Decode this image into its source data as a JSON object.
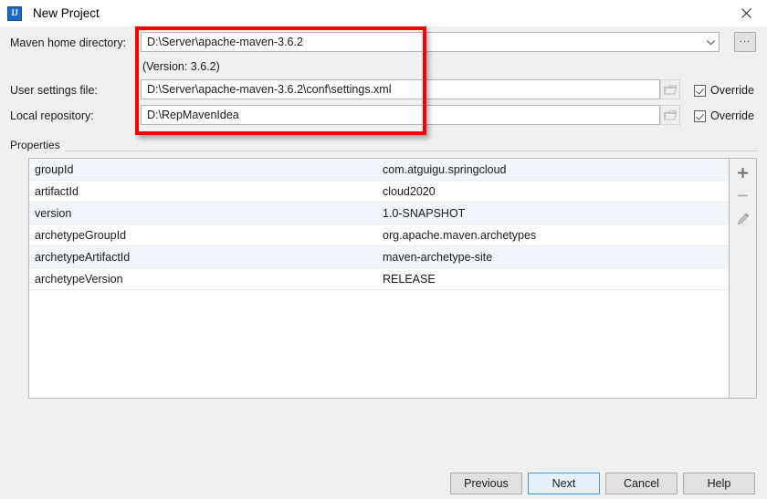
{
  "window": {
    "title": "New Project",
    "app_icon": "intellij-idea-icon",
    "close_icon": "close-icon"
  },
  "form": {
    "maven_home": {
      "label": "Maven home directory:",
      "value": "D:\\Server\\apache-maven-3.6.2",
      "placeholder": "",
      "dropdown_icon": "chevron-down-icon",
      "browse_label": "...",
      "version_note": "(Version: 3.6.2)"
    },
    "user_settings": {
      "label": "User settings file:",
      "value": "D:\\Server\\apache-maven-3.6.2\\conf\\settings.xml",
      "placeholder": "",
      "browse_icon": "folder-icon",
      "override_label": "Override",
      "override_checked": true
    },
    "local_repository": {
      "label": "Local repository:",
      "value": "D:\\RepMavenIdea",
      "placeholder": "",
      "browse_icon": "folder-icon",
      "override_label": "Override",
      "override_checked": true
    }
  },
  "properties": {
    "group_title": "Properties",
    "columns": [
      "",
      ""
    ],
    "rows": [
      {
        "key": "groupId",
        "value": "com.atguigu.springcloud"
      },
      {
        "key": "artifactId",
        "value": "cloud2020"
      },
      {
        "key": "version",
        "value": "1.0-SNAPSHOT"
      },
      {
        "key": "archetypeGroupId",
        "value": "org.apache.maven.archetypes"
      },
      {
        "key": "archetypeArtifactId",
        "value": "maven-archetype-site"
      },
      {
        "key": "archetypeVersion",
        "value": "RELEASE"
      }
    ],
    "toolbar": {
      "add_icon": "plus-icon",
      "remove_icon": "minus-icon",
      "edit_icon": "pencil-icon"
    }
  },
  "footer": {
    "previous": "Previous",
    "next": "Next",
    "cancel": "Cancel",
    "help": "Help"
  },
  "annotation": {
    "highlight_color": "#fc0000"
  }
}
